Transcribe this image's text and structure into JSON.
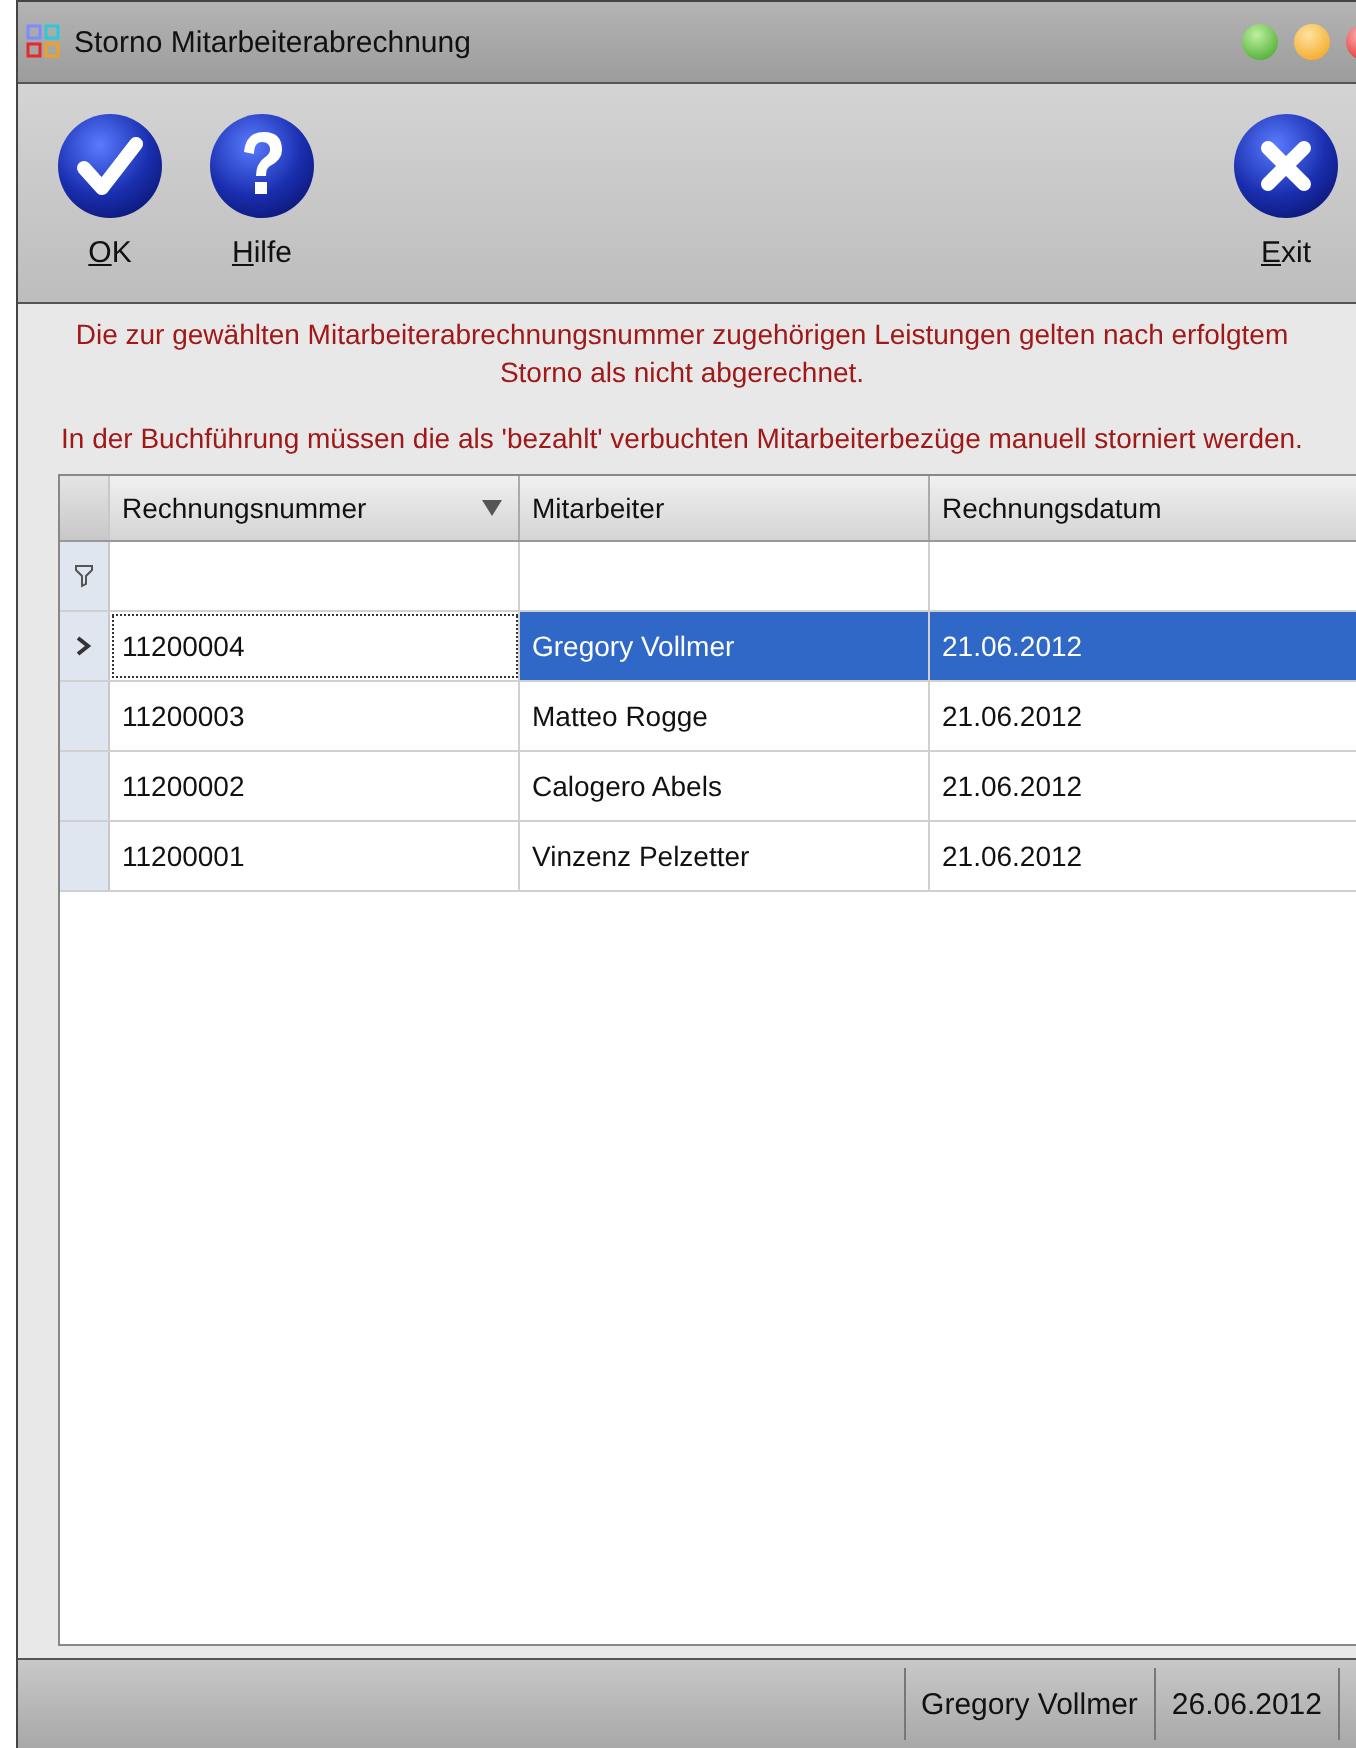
{
  "window": {
    "title": "Storno Mitarbeiterabrechnung"
  },
  "toolbar": [
    {
      "kind": "ok",
      "label": "OK"
    },
    {
      "kind": "help",
      "label": "Hilfe"
    },
    {
      "kind": "exit",
      "label": "Exit"
    }
  ],
  "message": [
    "Die zur gewählten Mitarbeiterabrechnungsnummer zugehörigen Leistungen gelten nach erfolgtem Storno als nicht abgerechnet.",
    "In der Buchführung müssen die als 'bezahlt' verbuchten Mitarbeiterbezüge manuell storniert werden."
  ],
  "table": {
    "columns": [
      {
        "label": "Rechnungsnummer",
        "sorted": true
      },
      {
        "label": "Mitarbeiter",
        "sorted": false
      },
      {
        "label": "Rechnungsdatum",
        "sorted": false
      }
    ],
    "rows": [
      {
        "cells": [
          "11200004",
          "Gregory Vollmer",
          "21.06.2012"
        ],
        "selected": true
      },
      {
        "cells": [
          "11200003",
          "Matteo Rogge",
          "21.06.2012"
        ],
        "selected": false
      },
      {
        "cells": [
          "11200002",
          "Calogero Abels",
          "21.06.2012"
        ],
        "selected": false
      },
      {
        "cells": [
          "11200001",
          "Vinzenz Pelzetter",
          "21.06.2012"
        ],
        "selected": false
      }
    ]
  },
  "status_bar": {
    "user": "Gregory Vollmer",
    "date": "26.06.2012"
  }
}
